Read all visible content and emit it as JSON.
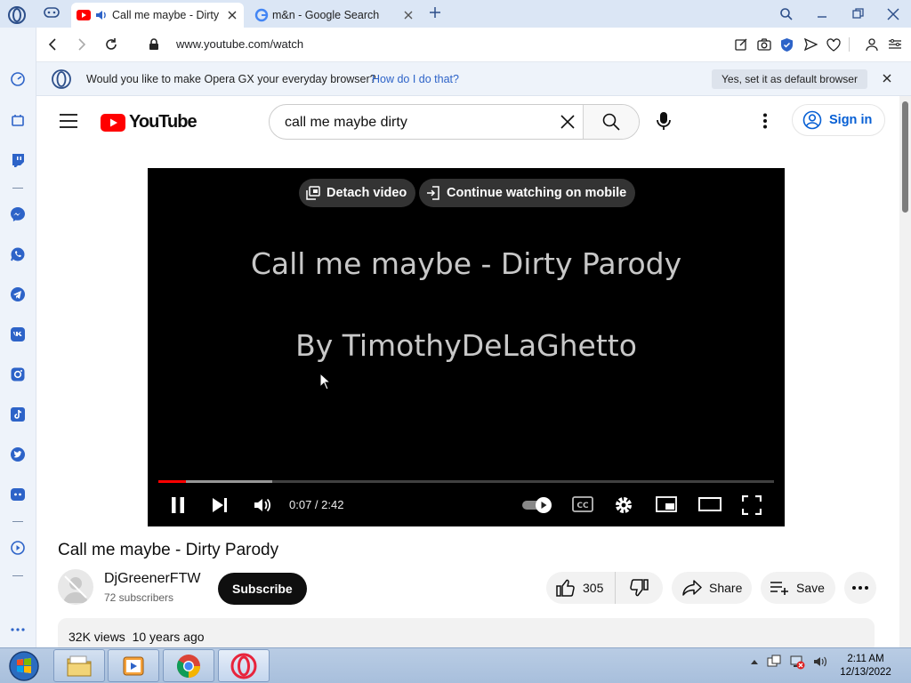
{
  "browser": {
    "tabs": [
      {
        "title": "Call me maybe - Dirty P",
        "active": true,
        "favicon": "youtube-icon",
        "audio": true
      },
      {
        "title": "m&n - Google Search",
        "active": false,
        "favicon": "google-icon"
      }
    ],
    "url": "www.youtube.com/watch",
    "infobar": {
      "message": "Would you like to make Opera GX your everyday browser?",
      "link": "How do I do that?",
      "button": "Yes, set it as default browser"
    },
    "sidebar_icons": [
      "speed-dial-icon",
      "gx-corner-icon",
      "twitch-icon",
      "messenger-icon",
      "whatsapp-icon",
      "telegram-icon",
      "vk-icon",
      "instagram-icon",
      "tiktok-icon",
      "twitter-icon",
      "discord-icon",
      "player-icon",
      "more-icon"
    ]
  },
  "youtube": {
    "logo": "YouTube",
    "search_value": "call me maybe dirty",
    "sign_in": "Sign in",
    "player": {
      "detach": "Detach video",
      "continue_mobile": "Continue watching on mobile",
      "title_line1": "Call me maybe - Dirty Parody",
      "title_line2": "By TimothyDeLaGhetto",
      "time": "0:07 / 2:42",
      "played_fraction": 0.045,
      "buffered_fraction": 0.185,
      "autoplay": true
    },
    "video_title": "Call me maybe - Dirty Parody",
    "channel": "DjGreenerFTW",
    "subscribers": "72 subscribers",
    "subscribe": "Subscribe",
    "likes": "305",
    "share": "Share",
    "save": "Save",
    "meta": "32K views  10 years ago",
    "brand_red": "#ff0000"
  },
  "taskbar": {
    "apps": [
      "explorer-icon",
      "media-player-icon",
      "chrome-icon",
      "opera-icon"
    ],
    "time": "2:11 AM",
    "date": "12/13/2022"
  }
}
